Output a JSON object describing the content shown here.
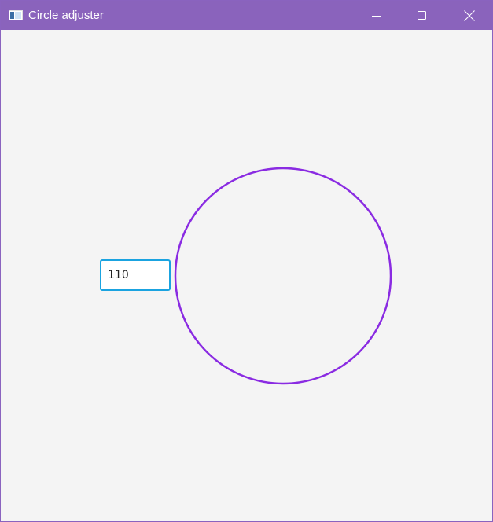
{
  "window": {
    "title": "Circle adjuster",
    "title_bar_color": "#8a63bc",
    "controls": {
      "minimize_icon": "minimize-icon",
      "maximize_icon": "maximize-icon",
      "close_icon": "close-icon"
    }
  },
  "radius_input": {
    "value": "110"
  },
  "circle": {
    "stroke_color": "#8a2be2"
  }
}
